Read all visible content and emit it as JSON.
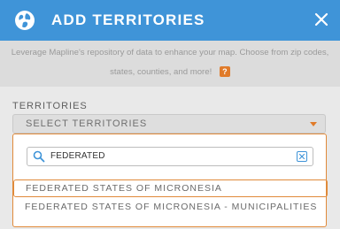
{
  "header": {
    "title": "ADD TERRITORIES",
    "color": "#3f94d8"
  },
  "description": {
    "line1": "Leverage Mapline's repository of data to enhance your map. Choose from zip codes,",
    "line2": "states, counties, and more!",
    "help": "?"
  },
  "territories": {
    "label": "TERRITORIES",
    "select_placeholder": "SELECT TERRITORIES",
    "search": {
      "value": "FEDERATED"
    },
    "options": [
      "FEDERATED STATES OF MICRONESIA",
      "FEDERATED STATES OF MICRONESIA - MUNICIPALITIES"
    ]
  },
  "accent_color": "#e07b2a",
  "icons": [
    "globe-icon",
    "close-icon",
    "caret-down-icon",
    "search-icon",
    "clear-icon",
    "help-icon"
  ]
}
